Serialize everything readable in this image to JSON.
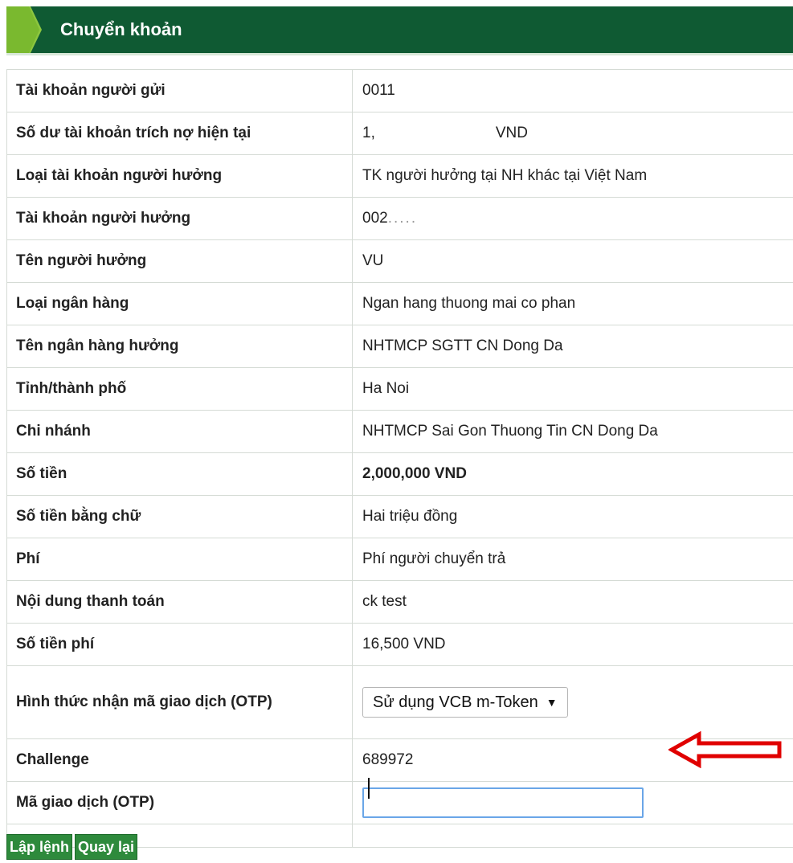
{
  "header": {
    "title": "Chuyển khoản",
    "accent_color": "#0f5a33"
  },
  "rows": {
    "sender_account": {
      "label": "Tài khoản người gửi",
      "value": "0011"
    },
    "balance": {
      "label": "Số dư tài khoản trích nợ hiện tại",
      "value_prefix": "1,",
      "value_currency": "VND"
    },
    "beneficiary_account_type": {
      "label": "Loại tài khoản người hưởng",
      "value": "TK người hưởng tại NH khác tại Việt Nam"
    },
    "beneficiary_account": {
      "label": "Tài khoản người hưởng",
      "value": "002",
      "value_masked": "....."
    },
    "beneficiary_name": {
      "label": "Tên người hưởng",
      "value": "VU"
    },
    "bank_type": {
      "label": "Loại ngân hàng",
      "value": "Ngan hang thuong mai co phan"
    },
    "beneficiary_bank": {
      "label": "Tên ngân hàng hưởng",
      "value": "NHTMCP SGTT CN Dong Da"
    },
    "province": {
      "label": "Tỉnh/thành phố",
      "value": "Ha Noi"
    },
    "branch": {
      "label": "Chi nhánh",
      "value": "NHTMCP Sai Gon Thuong Tin CN Dong Da"
    },
    "amount": {
      "label": "Số tiền",
      "value": "2,000,000 VND",
      "color": "#e60000"
    },
    "amount_words": {
      "label": "Số tiền bằng chữ",
      "value": "Hai triệu đồng"
    },
    "fee": {
      "label": "Phí",
      "value": "Phí người chuyển trả"
    },
    "payment_content": {
      "label": "Nội dung thanh toán",
      "value": "ck test"
    },
    "fee_amount": {
      "label": "Số tiền phí",
      "value": "16,500 VND"
    },
    "otp_method": {
      "label": "Hình thức nhận mã giao dịch (OTP)",
      "selected": "Sử dụng VCB m-Token",
      "arrow": "▼"
    },
    "challenge": {
      "label": "Challenge",
      "value": "689972"
    },
    "otp_code": {
      "label": "Mã giao dịch (OTP)",
      "value": "",
      "placeholder": ""
    }
  },
  "buttons": {
    "submit_label": "Lập lệnh",
    "back_label": "Quay lại"
  },
  "annotation": {
    "icon": "red-arrow-left-icon",
    "color": "#e00000"
  }
}
